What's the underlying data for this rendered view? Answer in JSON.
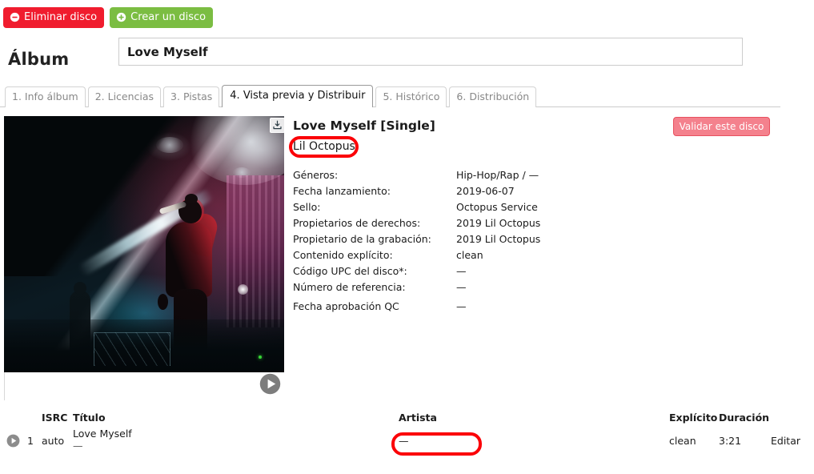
{
  "toolbar": {
    "delete_label": "Eliminar disco",
    "create_label": "Crear un disco",
    "delete_icon": "minus-circle-icon",
    "create_icon": "plus-circle-icon",
    "delete_color": "#f01c2e",
    "create_color": "#7bbd42"
  },
  "album": {
    "section_label": "Álbum",
    "title_value": "Love Myself",
    "title_placeholder": "Love Myself"
  },
  "tabs": [
    {
      "label": "1. Info álbum",
      "active": false
    },
    {
      "label": "2. Licencias",
      "active": false
    },
    {
      "label": "3. Pistas",
      "active": false
    },
    {
      "label": "4. Vista previa y Distribuir",
      "active": true
    },
    {
      "label": "5. Histórico",
      "active": false
    },
    {
      "label": "6. Distribución",
      "active": false
    }
  ],
  "preview": {
    "cover_icon": "download-icon",
    "play_icon": "play-circle-icon",
    "release_title": "Love Myself [Single]",
    "release_artist": "Lil Octopus",
    "validate_label": "Validar este disco",
    "validate_color": "#f4818d",
    "meta": [
      {
        "key": "Géneros:",
        "value": "Hip-Hop/Rap / —"
      },
      {
        "key": "Fecha lanzamiento:",
        "value": "2019-06-07"
      },
      {
        "key": "Sello:",
        "value": "Octopus Service"
      },
      {
        "key": "Propietarios de derechos:",
        "value": "2019 Lil Octopus"
      },
      {
        "key": "Propietario de la grabación:",
        "value": "2019 Lil Octopus"
      },
      {
        "key": "Contenido explícito:",
        "value": "clean"
      },
      {
        "key": "Código UPC del disco*:",
        "value": "—"
      },
      {
        "key": "Número de referencia:",
        "value": "—"
      },
      {
        "key": "Fecha aprobación QC",
        "value": "—"
      }
    ]
  },
  "tracks": {
    "headers": {
      "isrc": "ISRC",
      "title": "Título",
      "artist": "Artista",
      "explicit": "Explícito",
      "duration": "Duración"
    },
    "rows": [
      {
        "play_icon": "play-circle-icon",
        "number": "1",
        "isrc": "auto",
        "title": "Love Myself",
        "subtitle": "—",
        "artist": "—",
        "explicit": "clean",
        "duration": "3:21",
        "edit_label": "Editar"
      }
    ]
  },
  "annotations": {
    "color": "#fb0007",
    "items": [
      {
        "name": "release-artist-highlight",
        "target": "Lil Octopus"
      },
      {
        "name": "track-artist-highlight",
        "target": "—"
      }
    ]
  }
}
